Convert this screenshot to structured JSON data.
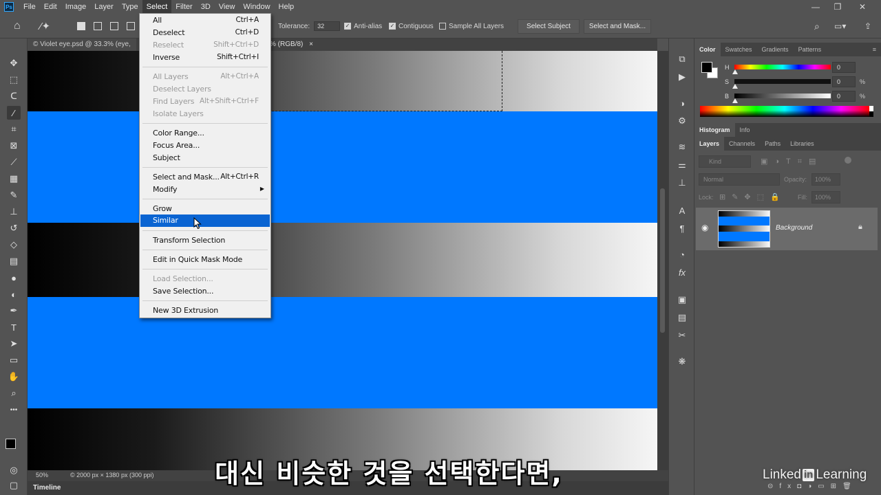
{
  "menubar": {
    "logo": "Ps",
    "items": [
      "File",
      "Edit",
      "Image",
      "Layer",
      "Type",
      "Select",
      "Filter",
      "3D",
      "View",
      "Window",
      "Help"
    ],
    "active": "Select"
  },
  "options": {
    "tolerance_label": "Tolerance:",
    "tolerance_value": "32",
    "antialias": "Anti-alias",
    "contiguous": "Contiguous",
    "sample_all": "Sample All Layers",
    "select_subject": "Select Subject",
    "select_and_mask": "Select and Mask..."
  },
  "document": {
    "tab_left": "© Violet eye.psd @ 33.3% (eye,",
    "tab_right": "% (RGB/8)",
    "close": "×",
    "zoom": "50%",
    "doc_size": "© 2000 px × 1380 px (300 ppi)",
    "timeline": "Timeline"
  },
  "select_menu": {
    "items": [
      {
        "label": "All",
        "shortcut": "Ctrl+A",
        "disabled": false
      },
      {
        "label": "Deselect",
        "shortcut": "Ctrl+D",
        "disabled": false
      },
      {
        "label": "Reselect",
        "shortcut": "Shift+Ctrl+D",
        "disabled": true
      },
      {
        "label": "Inverse",
        "shortcut": "Shift+Ctrl+I",
        "disabled": false
      },
      {
        "label": "All Layers",
        "shortcut": "Alt+Ctrl+A",
        "disabled": true
      },
      {
        "label": "Deselect Layers",
        "shortcut": "",
        "disabled": true
      },
      {
        "label": "Find Layers",
        "shortcut": "Alt+Shift+Ctrl+F",
        "disabled": true
      },
      {
        "label": "Isolate Layers",
        "shortcut": "",
        "disabled": true
      },
      {
        "label": "Color Range...",
        "shortcut": "",
        "disabled": false
      },
      {
        "label": "Focus Area...",
        "shortcut": "",
        "disabled": false
      },
      {
        "label": "Subject",
        "shortcut": "",
        "disabled": false
      },
      {
        "label": "Select and Mask...",
        "shortcut": "Alt+Ctrl+R",
        "disabled": false
      },
      {
        "label": "Modify",
        "shortcut": "",
        "disabled": false
      },
      {
        "label": "Grow",
        "shortcut": "",
        "disabled": false
      },
      {
        "label": "Similar",
        "shortcut": "",
        "disabled": false
      },
      {
        "label": "Transform Selection",
        "shortcut": "",
        "disabled": false
      },
      {
        "label": "Edit in Quick Mask Mode",
        "shortcut": "",
        "disabled": false
      },
      {
        "label": "Load Selection...",
        "shortcut": "",
        "disabled": true
      },
      {
        "label": "Save Selection...",
        "shortcut": "",
        "disabled": false
      },
      {
        "label": "New 3D Extrusion",
        "shortcut": "",
        "disabled": false
      }
    ],
    "highlighted": "Similar",
    "submenu_arrow": "▶"
  },
  "color_panel": {
    "tabs": [
      "Color",
      "Swatches",
      "Gradients",
      "Patterns"
    ],
    "active_tab": "Color",
    "h_label": "H",
    "h_value": "0",
    "s_label": "S",
    "s_value": "0",
    "s_unit": "%",
    "b_label": "B",
    "b_value": "0",
    "b_unit": "%"
  },
  "histogram_panel": {
    "tabs": [
      "Histogram",
      "Info"
    ],
    "active_tab": "Histogram"
  },
  "layers_panel": {
    "tabs": [
      "Layers",
      "Channels",
      "Paths",
      "Libraries"
    ],
    "active_tab": "Layers",
    "kind_placeholder": "Kind",
    "blend_mode": "Normal",
    "opacity_label": "Opacity:",
    "opacity_value": "100%",
    "lock_label": "Lock:",
    "fill_label": "Fill:",
    "fill_value": "100%",
    "layer_name": "Background"
  },
  "subtitle": "대신 비슷한 것을 선택한다면,",
  "watermark": {
    "pre": "Linked",
    "box": "in",
    "post": "Learning"
  },
  "colors": {
    "blue_band": "#0078ff",
    "menu_highlight": "#0a64d2",
    "panel_bg": "#535353"
  }
}
